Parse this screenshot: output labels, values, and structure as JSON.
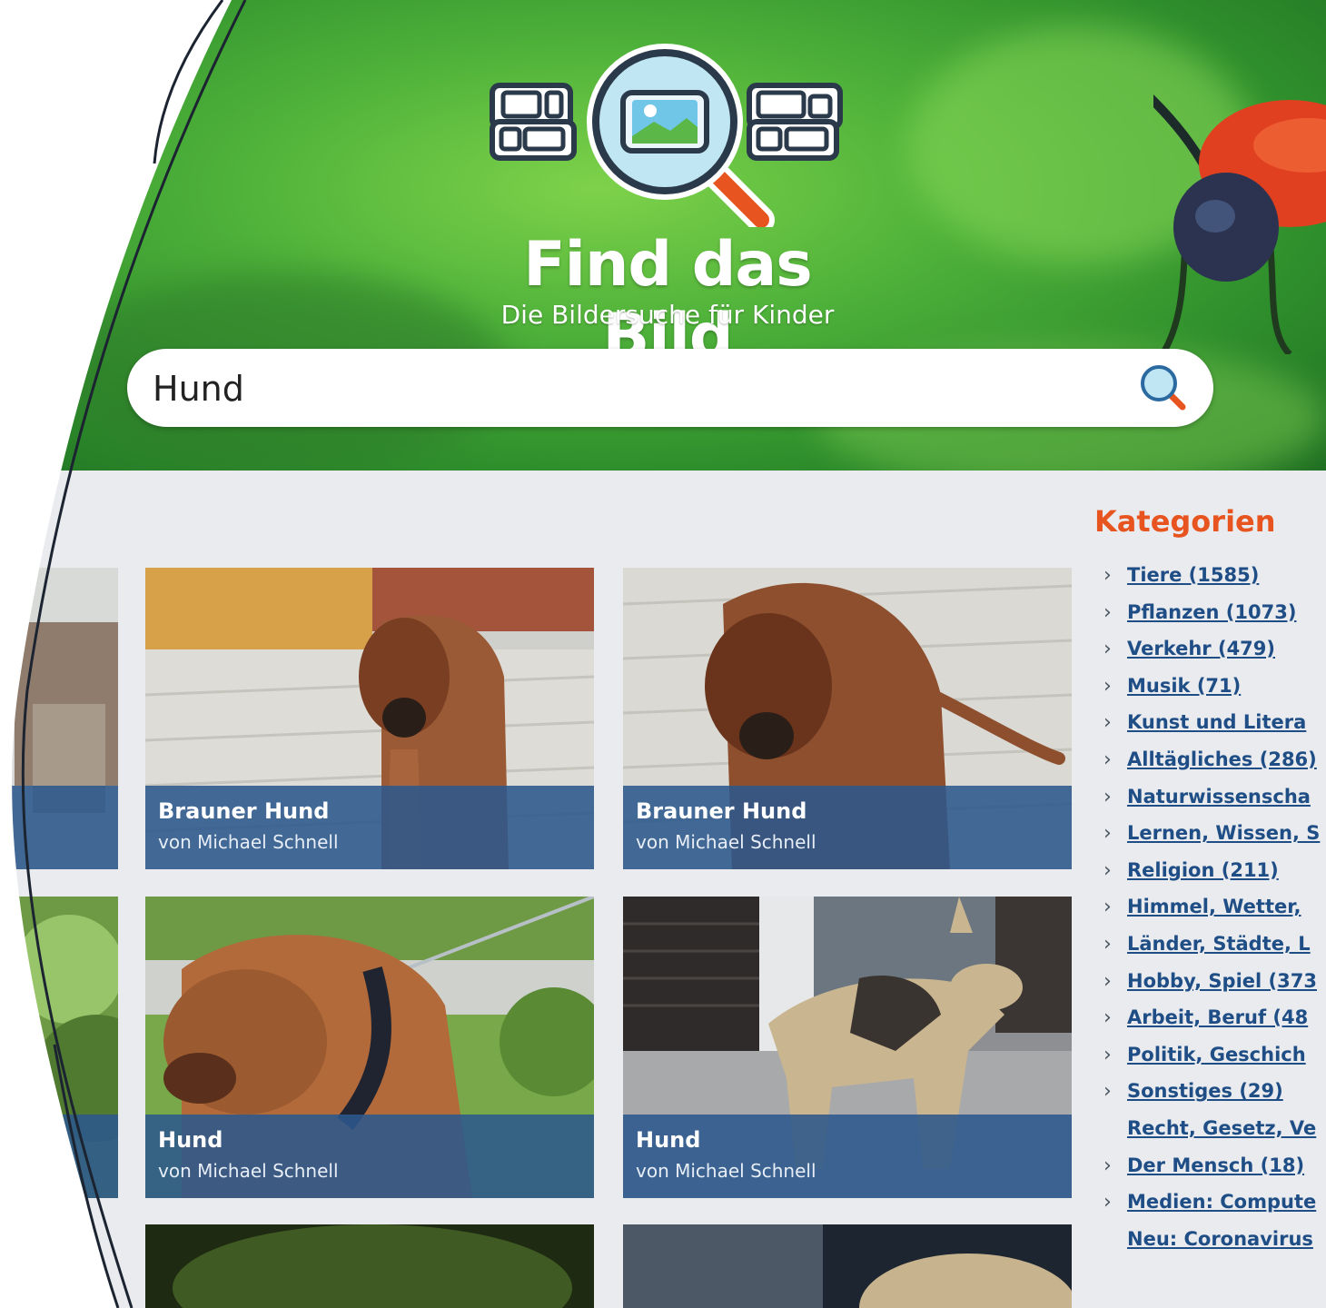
{
  "header": {
    "logo_title": "Find das Bild",
    "logo_subtitle": "Die Bildersuche für Kinder"
  },
  "search": {
    "value": "Hund",
    "button_icon": "search-icon"
  },
  "results": [
    {
      "title": "Brauner Hund",
      "author": "von Michael Schnell"
    },
    {
      "title": "Brauner Hund",
      "author": "von Michael Schnell"
    },
    {
      "title": "Hund",
      "author": "von Michael Schnell"
    },
    {
      "title": "Hund",
      "author": "von Michael Schnell"
    }
  ],
  "sidebar": {
    "title": "Kategorien",
    "items": [
      {
        "label": "Tiere (1585)"
      },
      {
        "label": "Pflanzen (1073)"
      },
      {
        "label": "Verkehr (479)"
      },
      {
        "label": "Musik (71)"
      },
      {
        "label": "Kunst und Litera"
      },
      {
        "label": "Alltägliches (286)"
      },
      {
        "label": "Naturwissenscha"
      },
      {
        "label": "Lernen, Wissen, S"
      },
      {
        "label": "Religion (211)"
      },
      {
        "label": "Himmel, Wetter,"
      },
      {
        "label": "Länder, Städte, L"
      },
      {
        "label": "Hobby, Spiel (373"
      },
      {
        "label": "Arbeit, Beruf (48"
      },
      {
        "label": "Politik, Geschich"
      },
      {
        "label": "Sonstiges (29)"
      },
      {
        "label": "Recht, Gesetz, Ve"
      },
      {
        "label": "Der Mensch (18)"
      },
      {
        "label": "Medien: Compute"
      },
      {
        "label": "Neu: Coronavirus"
      }
    ]
  },
  "colors": {
    "header_green": "#4fb23a",
    "caption_blue": "#2c588c",
    "category_title_orange": "#e8541f",
    "link_blue": "#1f4e86",
    "content_bg": "#e9ebee"
  }
}
